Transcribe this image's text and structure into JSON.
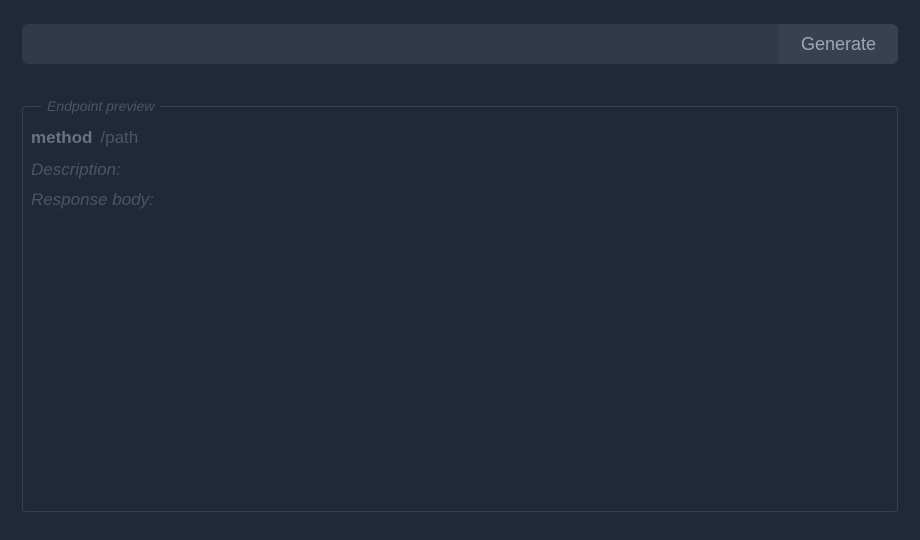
{
  "input": {
    "value": "",
    "placeholder": ""
  },
  "generate_button": {
    "label": "Generate"
  },
  "preview": {
    "legend": "Endpoint preview",
    "method": "method",
    "path": "/path",
    "description_label": "Description:",
    "response_label": "Response body:"
  }
}
